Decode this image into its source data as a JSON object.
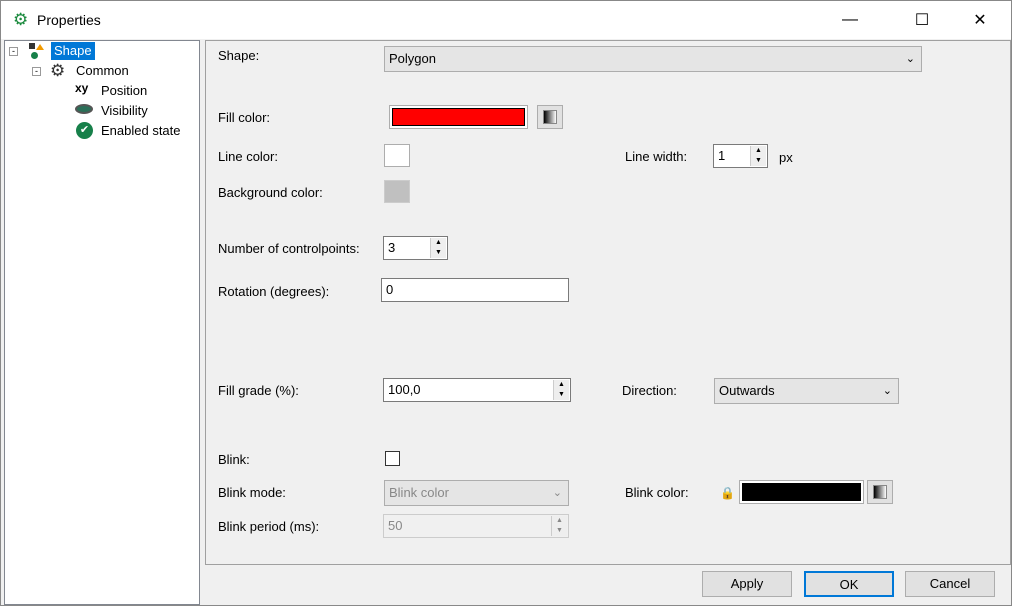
{
  "window": {
    "title": "Properties",
    "minimize": "—",
    "maximize": "☐",
    "close": "✕"
  },
  "tree": [
    {
      "label": "Shape",
      "icon": "shape-icon"
    },
    {
      "label": "Common",
      "icon": "gear-icon"
    },
    {
      "label": "Position",
      "icon": "xy-icon"
    },
    {
      "label": "Visibility",
      "icon": "eye-icon"
    },
    {
      "label": "Enabled state",
      "icon": "check-circle-icon"
    }
  ],
  "form": {
    "shape_label": "Shape:",
    "shape_value": "Polygon",
    "fill_color_label": "Fill color:",
    "fill_color": "#ff0000",
    "line_color_label": "Line color:",
    "line_color": "#ffffff",
    "line_width_label": "Line width:",
    "line_width": "1",
    "line_width_unit": "px",
    "bg_color_label": "Background color:",
    "bg_color": "#c0c0c0",
    "controlpoints_label": "Number of controlpoints:",
    "controlpoints": "3",
    "rotation_label": "Rotation (degrees):",
    "rotation": "0",
    "fill_grade_label": "Fill grade (%):",
    "fill_grade": "100,0",
    "direction_label": "Direction:",
    "direction": "Outwards",
    "blink_label": "Blink:",
    "blink_mode_label": "Blink mode:",
    "blink_mode": "Blink color",
    "blink_color_label": "Blink color:",
    "blink_color": "#000000",
    "blink_period_label": "Blink period (ms):",
    "blink_period": "50"
  },
  "buttons": {
    "apply": "Apply",
    "ok": "OK",
    "cancel": "Cancel"
  }
}
